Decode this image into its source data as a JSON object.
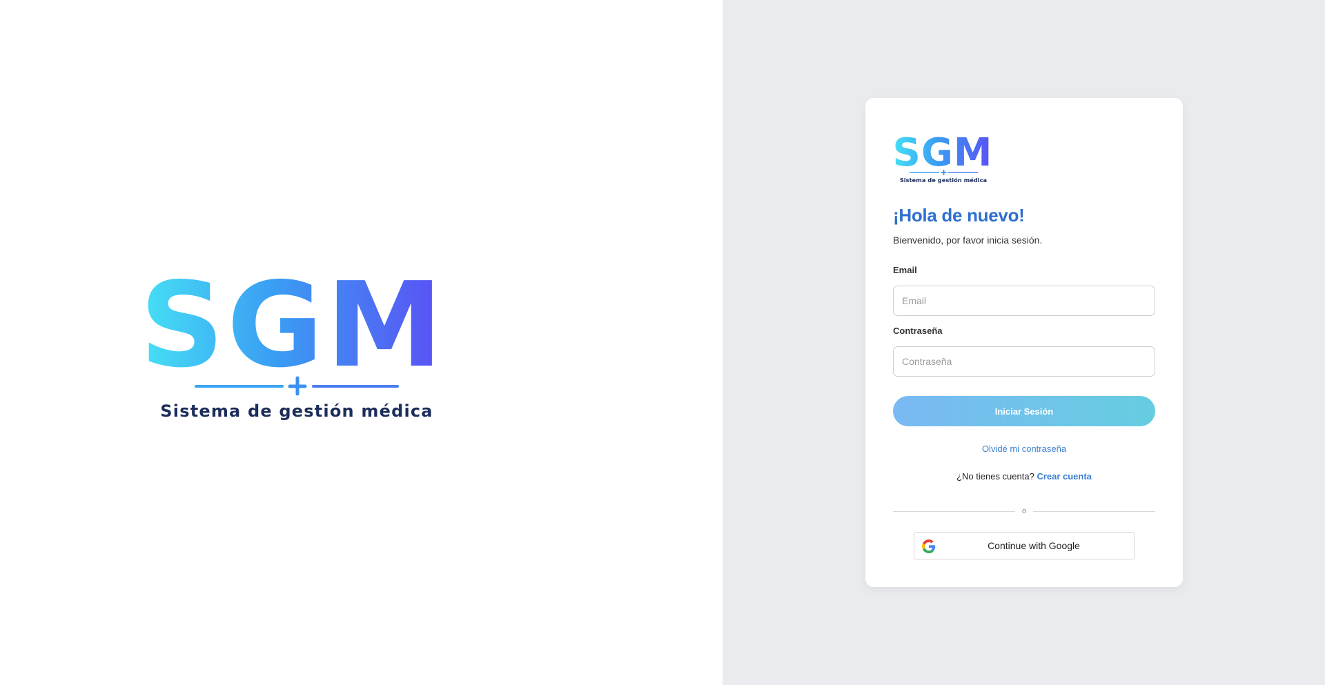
{
  "brand": {
    "logo_text": "SGM",
    "logo_tagline": "Sistema de gestión médica"
  },
  "login": {
    "title": "¡Hola de nuevo!",
    "subtitle": "Bienvenido, por favor inicia sesión.",
    "email_label": "Email",
    "email_placeholder": "Email",
    "email_value": "",
    "password_label": "Contraseña",
    "password_placeholder": "Contraseña",
    "password_value": "",
    "submit_label": "Iniciar Sesión",
    "forgot_label": "Olvidé mi contraseña",
    "no_account_text": "¿No tienes cuenta?",
    "signup_label": "Crear cuenta",
    "divider_text": "o",
    "google_label": "Continue with Google"
  },
  "colors": {
    "accent": "#2f6fce",
    "link": "#3b7fd1",
    "button_gradient_start": "#7ab9f3",
    "button_gradient_end": "#66cde0",
    "right_background": "#e9ebef"
  },
  "icons": {
    "google": "google-icon",
    "logo": "sgm-logo"
  }
}
